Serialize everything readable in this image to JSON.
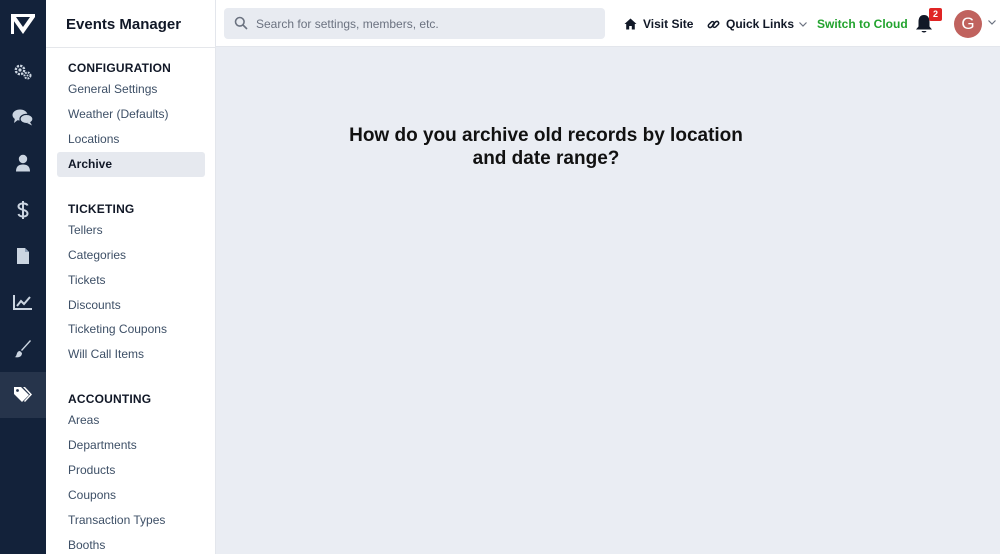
{
  "app": {
    "title": "Events Manager"
  },
  "rail": {
    "logo_icon": "app-logo",
    "items": [
      {
        "icon": "gears-icon"
      },
      {
        "icon": "comments-icon"
      },
      {
        "icon": "user-icon"
      },
      {
        "icon": "dollar-icon"
      },
      {
        "icon": "file-icon"
      },
      {
        "icon": "chart-line-icon"
      },
      {
        "icon": "brush-icon"
      },
      {
        "icon": "tags-icon",
        "active": true
      }
    ]
  },
  "sidebar": {
    "sections": [
      {
        "title": "CONFIGURATION",
        "items": [
          {
            "label": "General Settings"
          },
          {
            "label": "Weather (Defaults)"
          },
          {
            "label": "Locations"
          },
          {
            "label": "Archive",
            "active": true
          }
        ]
      },
      {
        "title": "TICKETING",
        "items": [
          {
            "label": "Tellers"
          },
          {
            "label": "Categories"
          },
          {
            "label": "Tickets"
          },
          {
            "label": "Discounts"
          },
          {
            "label": "Ticketing Coupons"
          },
          {
            "label": "Will Call Items"
          }
        ]
      },
      {
        "title": "ACCOUNTING",
        "items": [
          {
            "label": "Areas"
          },
          {
            "label": "Departments"
          },
          {
            "label": "Products"
          },
          {
            "label": "Coupons"
          },
          {
            "label": "Transaction Types"
          },
          {
            "label": "Booths"
          }
        ]
      }
    ]
  },
  "topbar": {
    "search_placeholder": "Search for settings, members, etc.",
    "search_value": "",
    "visit_site": "Visit Site",
    "quick_links": "Quick Links",
    "switch_cloud": "Switch to Cloud",
    "notification_count": "2",
    "avatar_initial": "G"
  },
  "main": {
    "question": "How do you archive old records by location and date range?"
  },
  "colors": {
    "rail_bg": "#13223a",
    "accent_green": "#22a32e",
    "badge_red": "#e02424",
    "avatar_bg": "#c0625e",
    "content_bg": "#eaedf3"
  }
}
